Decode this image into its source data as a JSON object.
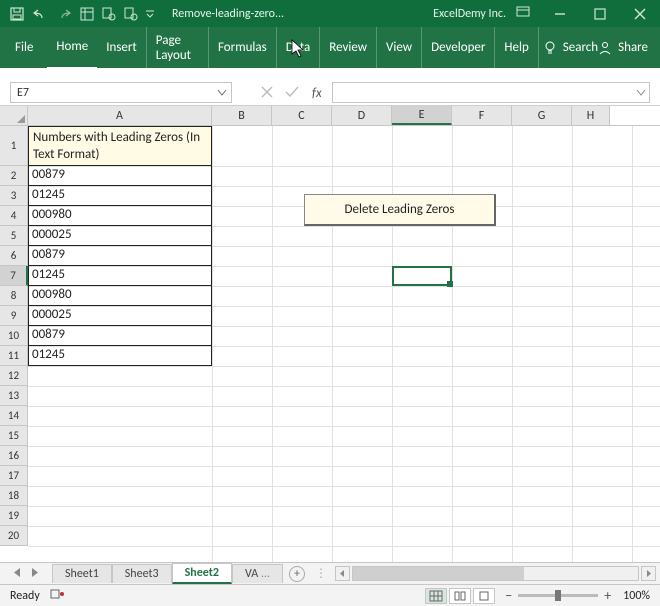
{
  "titlebar": {
    "filename": "Remove-leading-zero...",
    "company": "ExcelDemy Inc."
  },
  "ribbon": {
    "file": "File",
    "home": "Home",
    "insert": "Insert",
    "pagelayout": "Page Layout",
    "formulas": "Formulas",
    "data": "Data",
    "review": "Review",
    "view": "View",
    "developer": "Developer",
    "help": "Help",
    "search": "Search",
    "share": "Share"
  },
  "namebox": "E7",
  "formula_fx": "fx",
  "columns": [
    "A",
    "B",
    "C",
    "D",
    "E",
    "F",
    "G",
    "H"
  ],
  "rownums": [
    "1",
    "2",
    "3",
    "4",
    "5",
    "6",
    "7",
    "8",
    "9",
    "10",
    "11",
    "12",
    "13",
    "14",
    "15",
    "16",
    "17",
    "18",
    "19",
    "20"
  ],
  "table_header": "Numbers with Leading Zeros (In Text Format)",
  "table_values": [
    "00879",
    "01245",
    "000980",
    "000025",
    "00879",
    "01245",
    "000980",
    "000025",
    "00879",
    "01245"
  ],
  "button_label": "Delete Leading Zeros",
  "tabs": {
    "sheet1": "Sheet1",
    "sheet3": "Sheet3",
    "sheet2": "Sheet2",
    "va": "VA",
    "more": "..."
  },
  "status": {
    "ready": "Ready",
    "zoom": "100%",
    "plus": "+",
    "minus": "−"
  },
  "selected_cell": "E7"
}
